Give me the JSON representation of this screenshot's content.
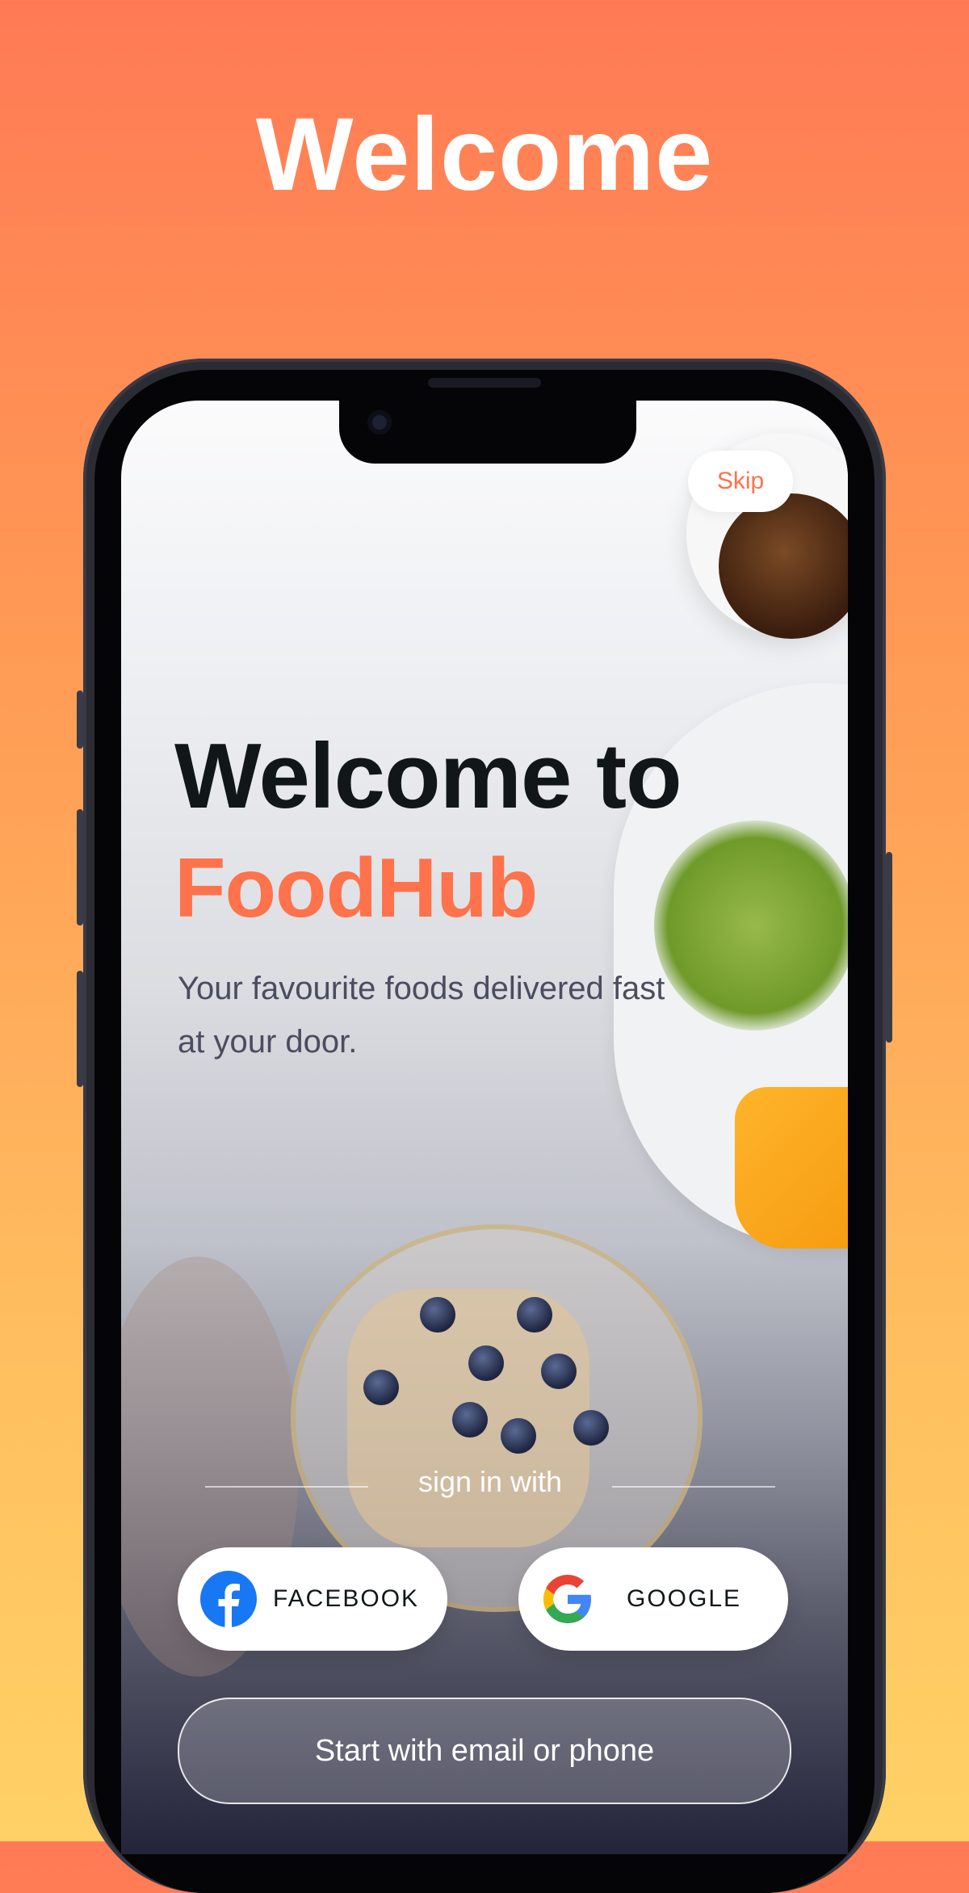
{
  "header": {
    "title": "Welcome"
  },
  "screen": {
    "skip_label": "Skip",
    "title_line1": "Welcome to",
    "title_line2": "FoodHub",
    "subtitle": "Your favourite foods delivered fast at your door.",
    "divider_label": "sign in with",
    "facebook_label": "FACEBOOK",
    "google_label": "GOOGLE",
    "email_button_label": "Start with email or phone"
  },
  "colors": {
    "accent": "#fe724c",
    "title_dark": "#111719",
    "background_top": "#ff7a55",
    "background_bottom": "#ffd166",
    "facebook_blue": "#1877f2"
  },
  "icons": [
    "facebook-icon",
    "google-icon"
  ]
}
